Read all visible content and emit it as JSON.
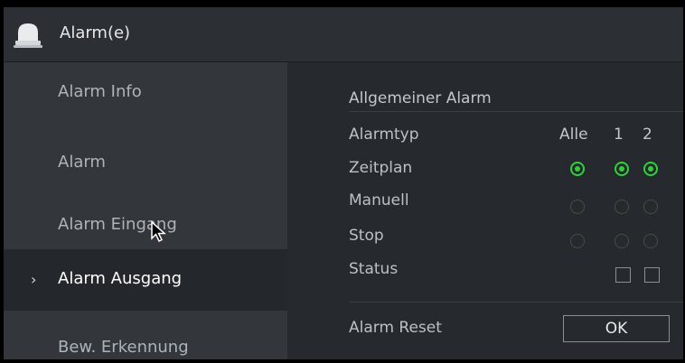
{
  "window": {
    "title": "Alarm(e)",
    "icon": "alarm-bell-icon"
  },
  "sidebar": {
    "items": [
      {
        "label": "Alarm Info",
        "active": false
      },
      {
        "label": "Alarm",
        "active": false
      },
      {
        "label": "Alarm Eingang",
        "active": false
      },
      {
        "label": "Alarm Ausgang",
        "active": true
      },
      {
        "label": "Bew. Erkennung",
        "active": false
      }
    ],
    "active_marker": "›"
  },
  "main": {
    "section_title": "Allgemeiner Alarm",
    "header_label": "Alarmtyp",
    "columns": [
      "Alle",
      "1",
      "2"
    ],
    "rows": [
      {
        "label": "Zeitplan",
        "selected": [
          true,
          true,
          true
        ]
      },
      {
        "label": "Manuell",
        "selected": [
          false,
          false,
          false
        ]
      },
      {
        "label": "Stop",
        "selected": [
          false,
          false,
          false
        ]
      },
      {
        "label": "Status",
        "checkboxes": [
          false,
          false
        ]
      }
    ],
    "reset_label": "Alarm Reset",
    "ok_label": "OK"
  },
  "colors": {
    "accent_green": "#2fd13a",
    "background": "#262a2e",
    "sidebar_bg": "#33373c"
  }
}
